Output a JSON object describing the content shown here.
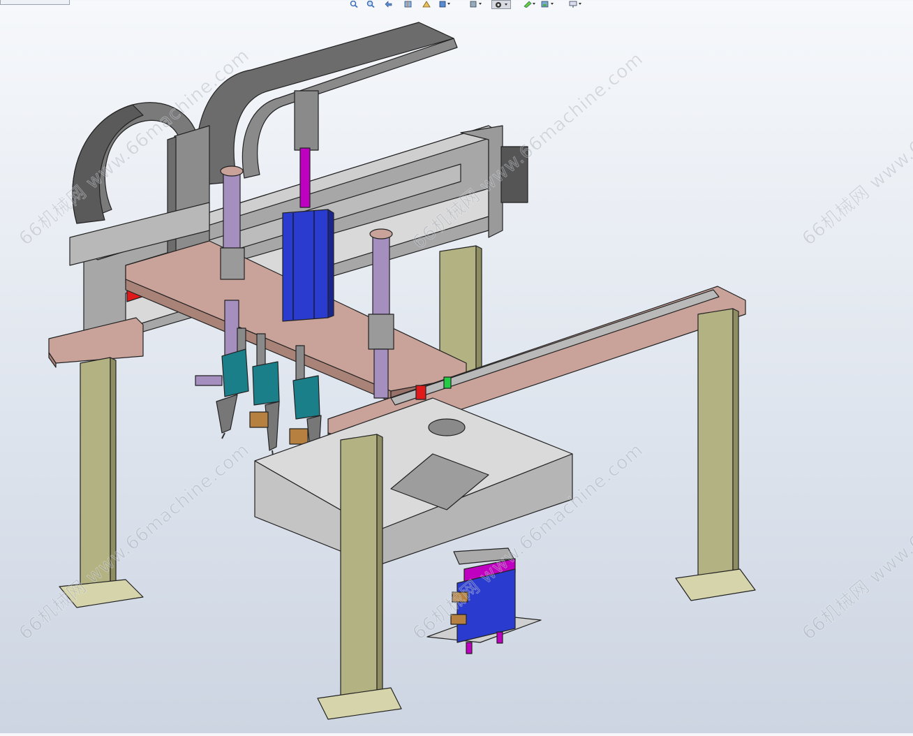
{
  "toolbar": {
    "items": [
      {
        "name": "zoom-fit-icon"
      },
      {
        "name": "zoom-area-icon"
      },
      {
        "name": "previous-view-icon"
      },
      {
        "name": "section-view-icon"
      },
      {
        "name": "dynamic-annotation-icon"
      },
      {
        "name": "view-orientation-icon"
      },
      {
        "name": "display-style-icon"
      },
      {
        "name": "hide-show-items-icon"
      },
      {
        "name": "edit-appearance-icon"
      },
      {
        "name": "apply-scene-icon"
      },
      {
        "name": "view-settings-icon"
      }
    ]
  },
  "watermark": {
    "text": "66机械网 www.66machine.com"
  },
  "colors": {
    "frame_leg": "#a9a878",
    "plate": "#c9a39a",
    "cable_chain": "#6e6e6e",
    "cylinder_blue": "#2a3bd0",
    "rod_purple": "#a58fbf",
    "rod_magenta": "#c000c0",
    "nozzle_teal": "#1b7f8a",
    "rail_grey": "#b9b9b9",
    "tray_grey": "#c8c8c8",
    "red_block": "#e01a1a",
    "green_block": "#22cc44"
  }
}
